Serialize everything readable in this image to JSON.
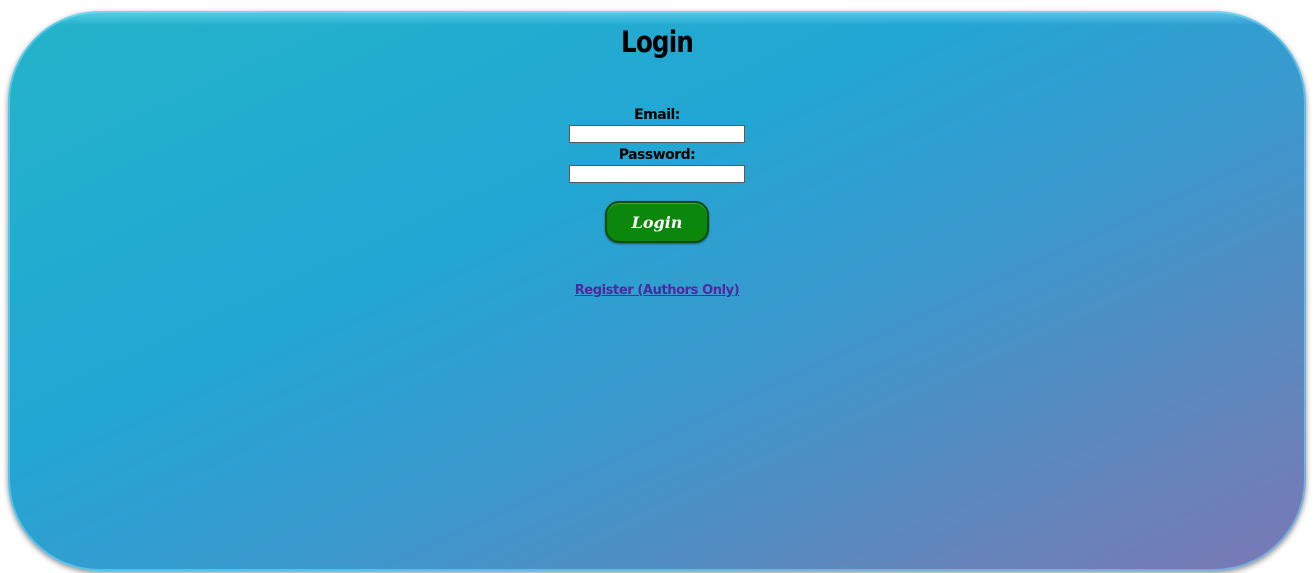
{
  "page": {
    "title": "Login"
  },
  "form": {
    "email_label": "Email:",
    "email_value": "",
    "password_label": "Password:",
    "password_value": "",
    "submit_label": "Login"
  },
  "links": {
    "register": "Register (Authors Only)"
  },
  "colors": {
    "panel_gradient_start": "#23b4c9",
    "panel_gradient_end": "#7b77b4",
    "button_bg": "#0b870b",
    "link_color": "#4b2aa0"
  }
}
